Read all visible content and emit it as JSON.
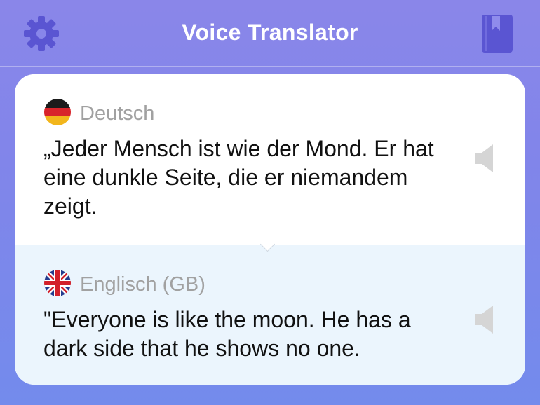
{
  "header": {
    "title": "Voice Translator",
    "settings_icon": "gear-icon",
    "phrasebook_icon": "bookmark-book-icon"
  },
  "source": {
    "language": "Deutsch",
    "flag": "germany-flag-icon",
    "text": "„Jeder Mensch ist wie der Mond. Er hat eine dunkle Seite, die er niemandem zeigt."
  },
  "target": {
    "language": "Englisch (GB)",
    "flag": "united-kingdom-flag-icon",
    "text": "\"Everyone is like the moon. He has a dark side that he shows no one."
  },
  "colors": {
    "header_gradient_top": "#8a86e9",
    "header_gradient_bottom": "#738bec",
    "icon_accent": "#5a55d2",
    "target_panel_bg": "#ebf5fd",
    "label_gray": "#a1a1a1",
    "speaker_gray": "#d5d5d5"
  }
}
